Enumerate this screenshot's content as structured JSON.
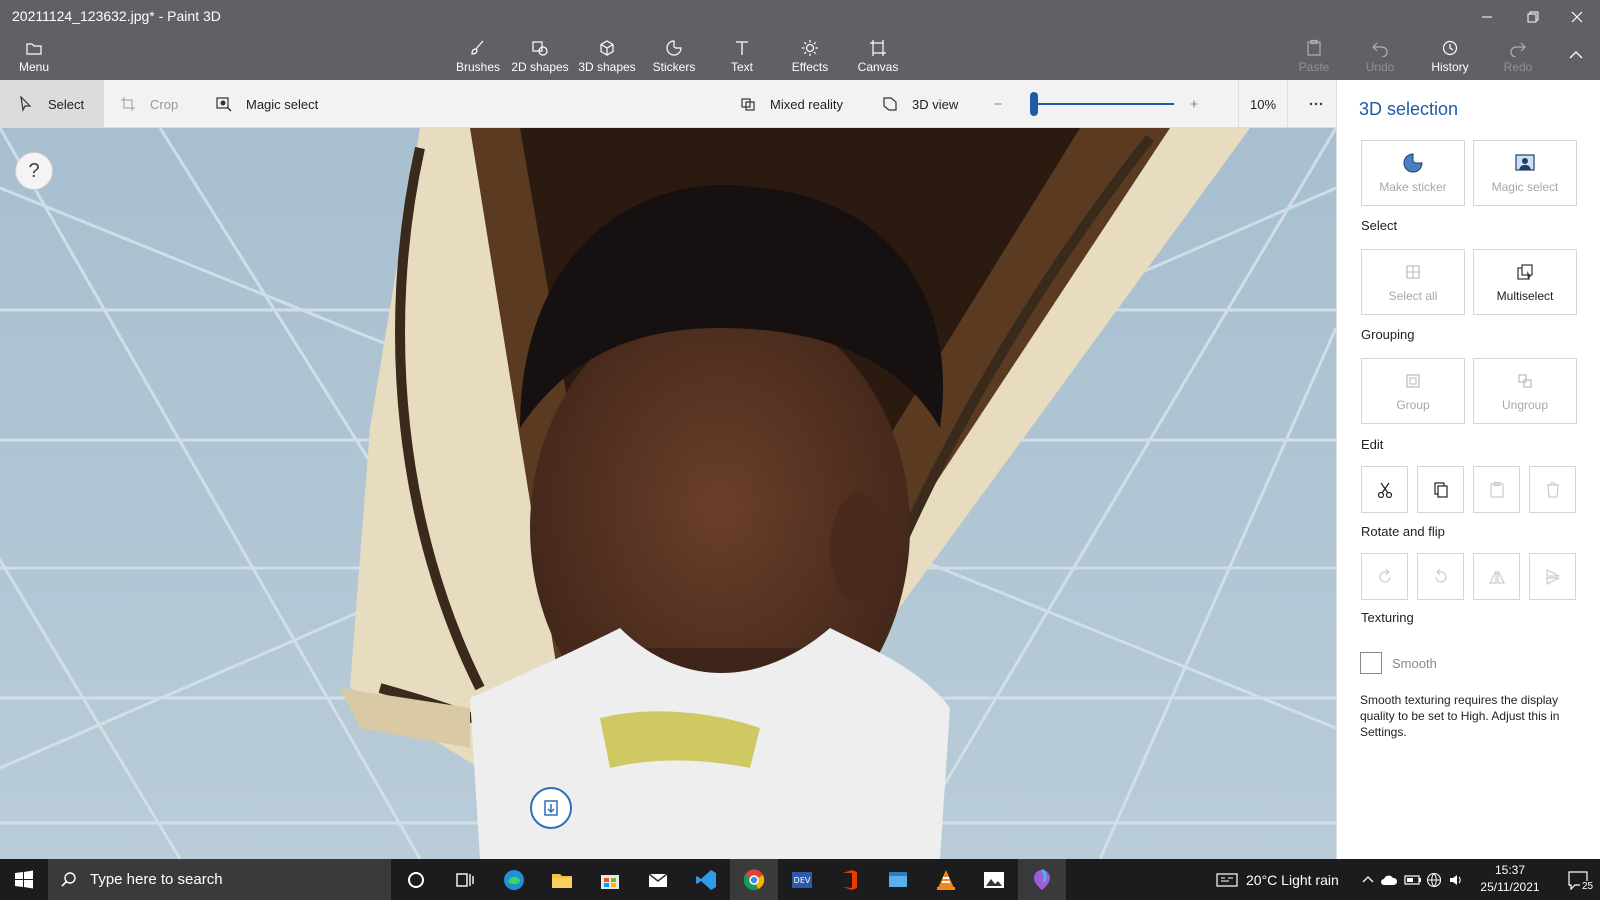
{
  "window": {
    "title": "20211124_123632.jpg* - Paint 3D",
    "minimize_icon": "minimize-icon",
    "restore_icon": "restore-icon",
    "close_icon": "close-icon"
  },
  "toolbar": {
    "menu_label": "Menu",
    "tools": [
      {
        "label": "Brushes",
        "icon": "brush-icon"
      },
      {
        "label": "2D shapes",
        "icon": "2d-shapes-icon"
      },
      {
        "label": "3D shapes",
        "icon": "3d-cube-icon"
      },
      {
        "label": "Stickers",
        "icon": "sticker-icon"
      },
      {
        "label": "Text",
        "icon": "text-icon"
      },
      {
        "label": "Effects",
        "icon": "sun-icon"
      },
      {
        "label": "Canvas",
        "icon": "canvas-icon"
      }
    ],
    "paste_label": "Paste",
    "undo_label": "Undo",
    "history_label": "History",
    "redo_label": "Redo"
  },
  "subbar": {
    "select_label": "Select",
    "crop_label": "Crop",
    "magic_select_label": "Magic select",
    "mixed_reality_label": "Mixed reality",
    "view_3d_label": "3D view",
    "zoom_level": "10%",
    "zoom_fraction": 0.0
  },
  "canvas": {
    "help_label": "?"
  },
  "panel": {
    "title": "3D selection",
    "make_sticker_label": "Make sticker",
    "magic_select_label": "Magic select",
    "select_section": "Select",
    "select_all_label": "Select all",
    "multiselect_label": "Multiselect",
    "grouping_section": "Grouping",
    "group_label": "Group",
    "ungroup_label": "Ungroup",
    "edit_section": "Edit",
    "rotate_section": "Rotate and flip",
    "texturing_section": "Texturing",
    "smooth_label": "Smooth",
    "smooth_note": "Smooth texturing requires the display quality to be set to High. Adjust this in Settings."
  },
  "taskbar": {
    "search_placeholder": "Type here to search",
    "weather": "20°C  Light rain",
    "time": "15:37",
    "date": "25/11/2021",
    "notifications": "25"
  }
}
